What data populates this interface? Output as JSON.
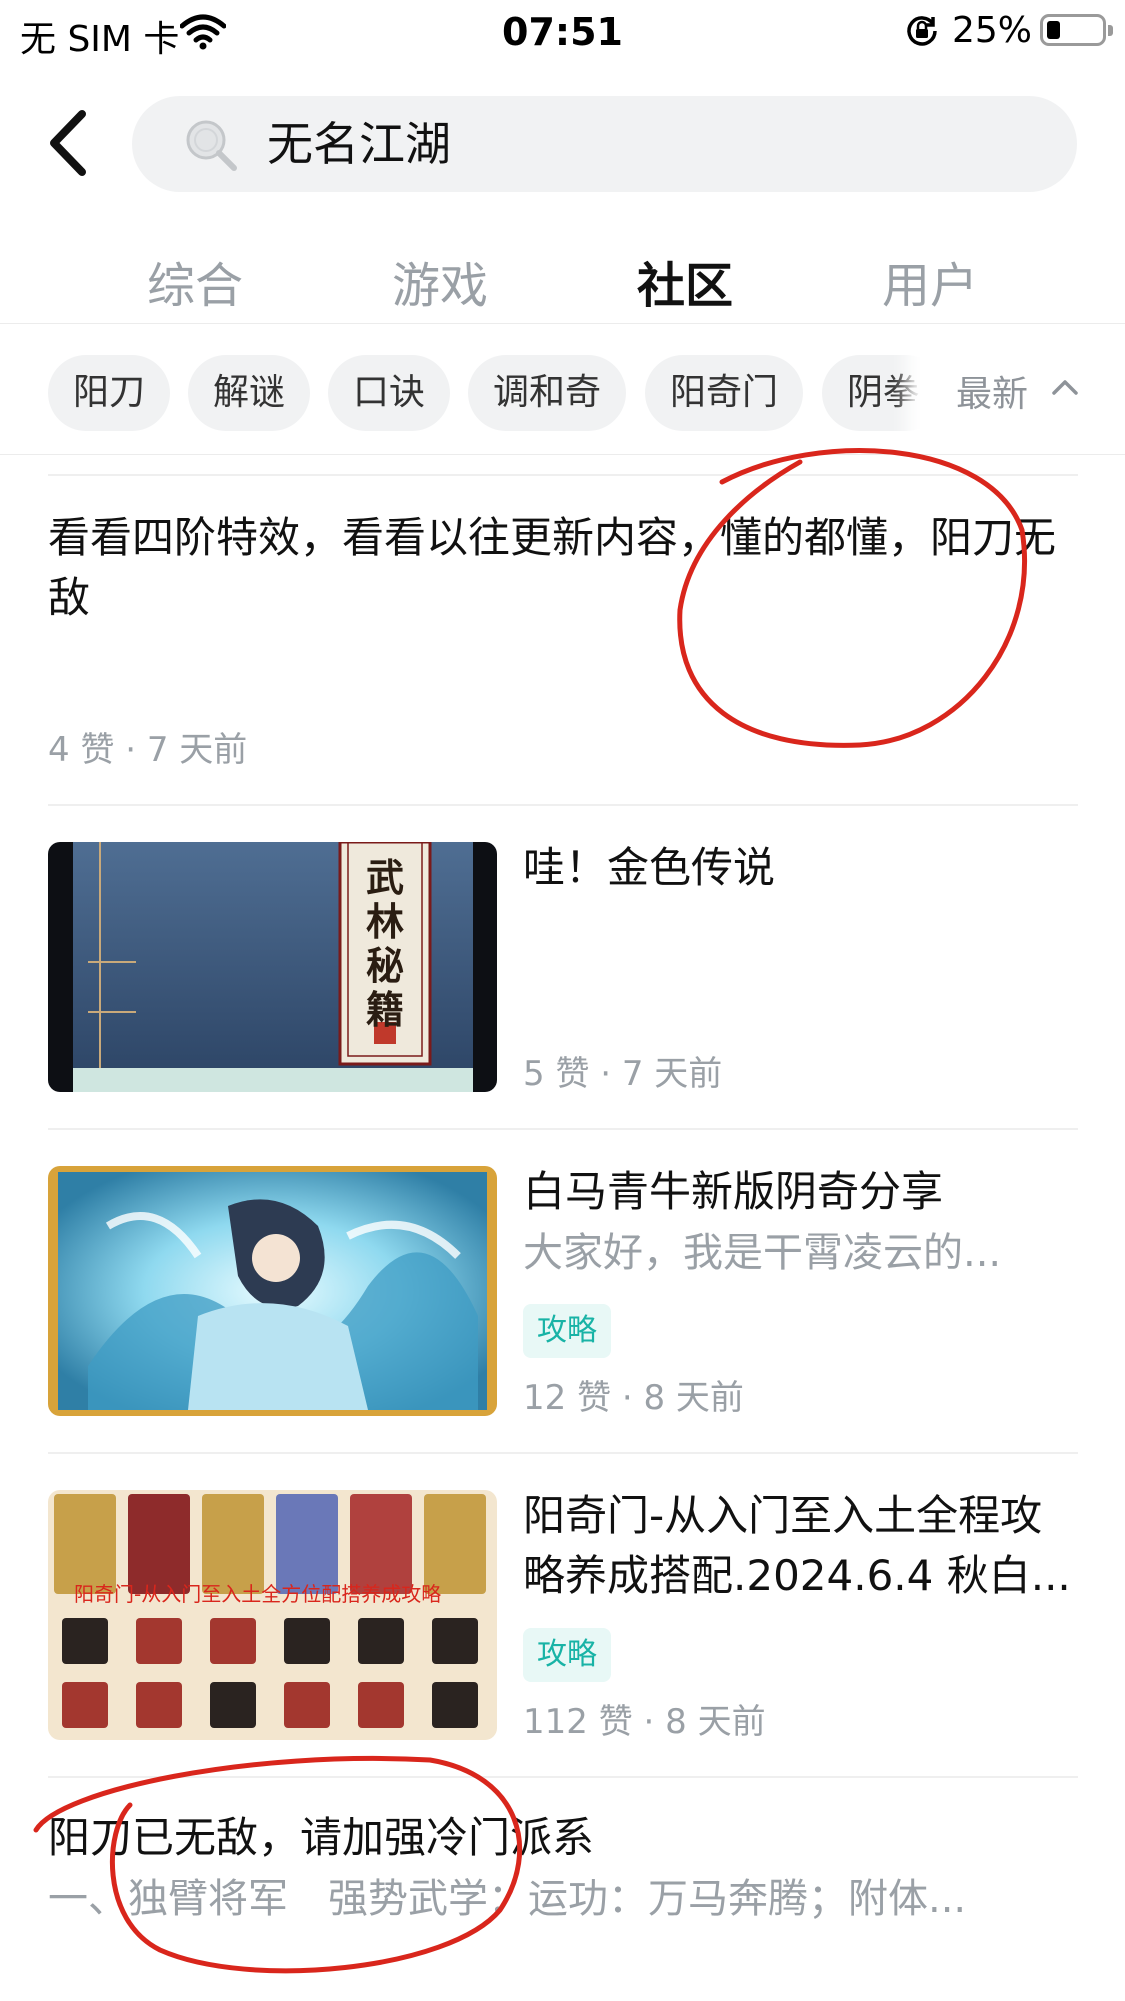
{
  "status_bar": {
    "carrier": "无 SIM 卡",
    "time": "07:51",
    "battery": "25%",
    "battery_level": 0.25,
    "icons": [
      "wifi-icon",
      "orientation-lock-icon",
      "battery-icon"
    ]
  },
  "header": {
    "back_icon": "chevron-left-icon",
    "search_icon": "search-icon",
    "search_value": "无名江湖"
  },
  "tabs": [
    {
      "label": "综合",
      "active": false
    },
    {
      "label": "游戏",
      "active": false
    },
    {
      "label": "社区",
      "active": true
    },
    {
      "label": "用户",
      "active": false
    }
  ],
  "filters": {
    "chips": [
      "阳刀",
      "解谜",
      "口诀",
      "调和奇",
      "阳奇门",
      "阴拳"
    ],
    "sort_label": "最新",
    "sort_icon": "chevron-up-icon"
  },
  "posts": [
    {
      "text": "看看四阶特效，看看以往更新内容，懂的都懂，阳刀无敌",
      "meta": "4 赞 · 7 天前"
    },
    {
      "title": "哇！金色传说",
      "meta": "5 赞 · 7 天前",
      "thumb_text": "武林秘籍"
    },
    {
      "title": "白马青牛新版阴奇分享",
      "summary": "大家好，我是干霄凌云的...",
      "tag": "攻略",
      "meta": "12 赞 · 8 天前"
    },
    {
      "title": "阳奇门-从入门至入土全程攻略养成搭配.2024.6.4 秋白...",
      "tag": "攻略",
      "meta": "112 赞 · 8 天前",
      "thumb_banner": "阳奇门-从入门至入土全方位配搭养成攻略"
    },
    {
      "title": "阳刀已无敌，请加强冷门派系",
      "summary": "一、独臂将军　强势武学：运功：万马奔腾；附体..."
    }
  ],
  "colors": {
    "accent": "#19c6b8",
    "annotation": "#d9261c"
  }
}
